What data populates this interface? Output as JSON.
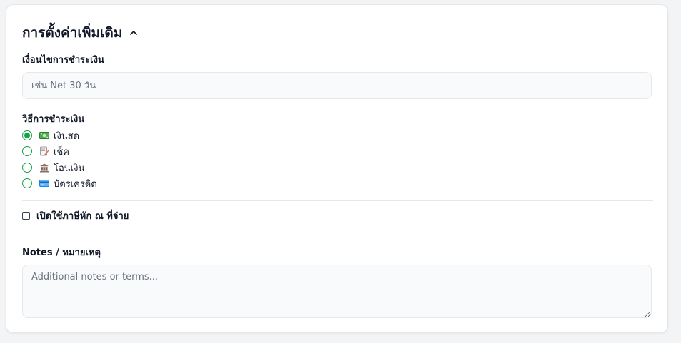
{
  "section": {
    "title": "การตั้งค่าเพิ่มเติม",
    "expanded": true
  },
  "payment_terms": {
    "label": "เงื่อนไขการชำระเงิน",
    "value": "",
    "placeholder": "เช่น Net 30 วัน"
  },
  "payment_method": {
    "label": "วิธีการชำระเงิน",
    "selected": "cash",
    "options": [
      {
        "id": "cash",
        "label": "เงินสด",
        "icon": "cash-icon"
      },
      {
        "id": "cheque",
        "label": "เช็ค",
        "icon": "memo-icon"
      },
      {
        "id": "transfer",
        "label": "โอนเงิน",
        "icon": "bank-icon"
      },
      {
        "id": "credit",
        "label": "บัตรเครดิต",
        "icon": "credit-card-icon"
      }
    ]
  },
  "withholding_tax": {
    "label": "เปิดใช้ภาษีหัก ณ ที่จ่าย",
    "checked": false
  },
  "notes": {
    "label": "Notes / หมายเหตุ",
    "value": "",
    "placeholder": "Additional notes or terms..."
  },
  "colors": {
    "accent": "#16a34a",
    "border": "#e5e7eb",
    "input_bg": "#f9fafb"
  }
}
